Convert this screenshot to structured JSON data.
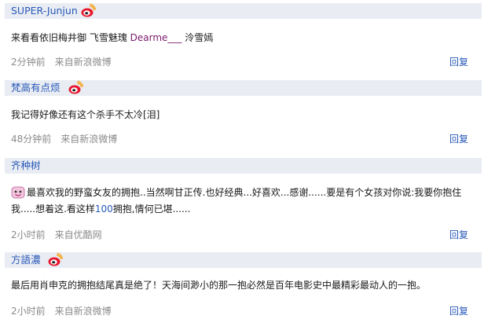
{
  "comments": [
    {
      "username": "SUPER-Junjun",
      "has_weibo_icon": true,
      "text_pre": "来看看依旧梅井御  飞雪魅瑰  ",
      "text_mention": "Dearme___",
      "text_post": "  泠雪嫣",
      "time": "2分钟前",
      "source": "来自新浪微博",
      "reply": "回复"
    },
    {
      "username": "梵高有点烦",
      "has_weibo_icon": true,
      "text": "我记得好像还有这个杀手不太冷[泪]",
      "time": "48分钟前",
      "source": "来自新浪微博",
      "reply": "回复"
    },
    {
      "username": "齐种树",
      "has_weibo_icon": false,
      "emoticon": "smiley-emoticon",
      "text_pre": "最喜欢我的野蛮女友的拥抱..当然啊甘正传.也好经典...好喜欢...感谢......要是有个女孩对你说:我要你抱住我.....想着这.看这样",
      "text_num": "100",
      "text_post": "拥抱,情何已堪......",
      "time": "2小时前",
      "source": "来自优酷网",
      "reply": "回复"
    },
    {
      "username": "方語濃",
      "has_weibo_icon": true,
      "text": "最后用肖申克的拥抱结尾真是绝了！天海间渺小的那一抱必然是百年电影史中最精彩最动人的一抱。",
      "time": "2小时前",
      "source": "来自新浪微博",
      "reply": "回复"
    }
  ],
  "colors": {
    "header_bg": "#e9edf3",
    "link_blue": "#2858b8",
    "meta_gray": "#8a8a8a",
    "mention_purple": "#7a1a6b",
    "weibo_red": "#e6162d",
    "weibo_yellow": "#f5a623"
  }
}
